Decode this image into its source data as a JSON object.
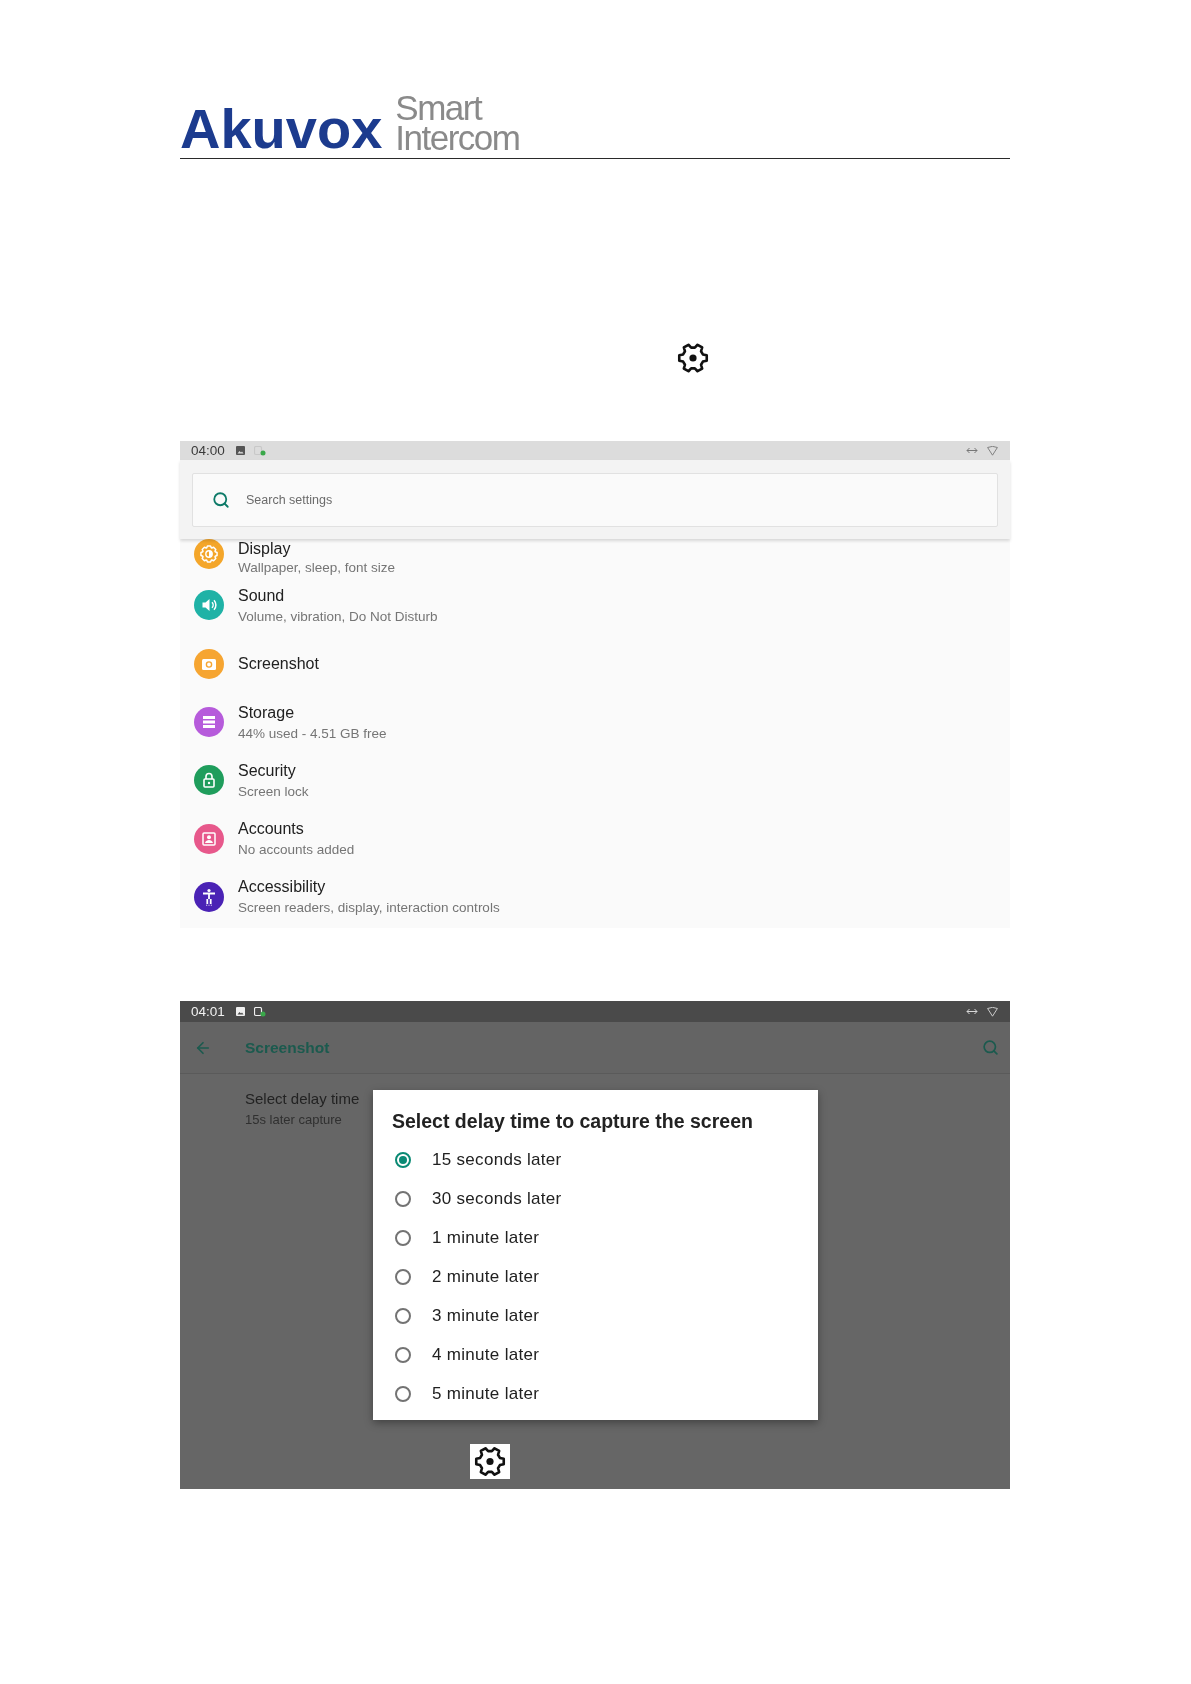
{
  "header": {
    "wordmark": "Akuvox",
    "tagline": "Smart Intercom"
  },
  "settings_screen": {
    "status_bar": {
      "time": "04:00"
    },
    "search": {
      "placeholder": "Search settings"
    },
    "items": [
      {
        "kind": "display",
        "title": "Display",
        "subtitle": "Wallpaper, sleep, font size",
        "color": "#f4a62a"
      },
      {
        "kind": "sound",
        "title": "Sound",
        "subtitle": "Volume, vibration, Do Not Disturb",
        "color": "#1fb2a6"
      },
      {
        "kind": "screenshot",
        "title": "Screenshot",
        "color": "#f6a531"
      },
      {
        "kind": "storage",
        "title": "Storage",
        "subtitle": "44% used - 4.51 GB free",
        "color": "#b65bdb"
      },
      {
        "kind": "security",
        "title": "Security",
        "subtitle": "Screen lock",
        "color": "#1f9d5c"
      },
      {
        "kind": "accounts",
        "title": "Accounts",
        "subtitle": "No accounts added",
        "color": "#e7588b"
      },
      {
        "kind": "accessibility",
        "title": "Accessibility",
        "subtitle": "Screen readers, display, interaction controls",
        "color": "#4a22b5"
      }
    ]
  },
  "screenshot_screen": {
    "status_bar": {
      "time": "04:01"
    },
    "app_bar": {
      "title": "Screenshot"
    },
    "preference": {
      "title": "Select delay time",
      "summary": "15s later capture"
    },
    "dialog": {
      "title": "Select delay time to capture the screen",
      "options": [
        {
          "label": "15 seconds later",
          "selected": true
        },
        {
          "label": "30 seconds later",
          "selected": false
        },
        {
          "label": "1 minute later",
          "selected": false
        },
        {
          "label": "2 minute later",
          "selected": false
        },
        {
          "label": "3 minute later",
          "selected": false
        },
        {
          "label": "4 minute later",
          "selected": false
        },
        {
          "label": "5 minute later",
          "selected": false
        }
      ]
    }
  }
}
